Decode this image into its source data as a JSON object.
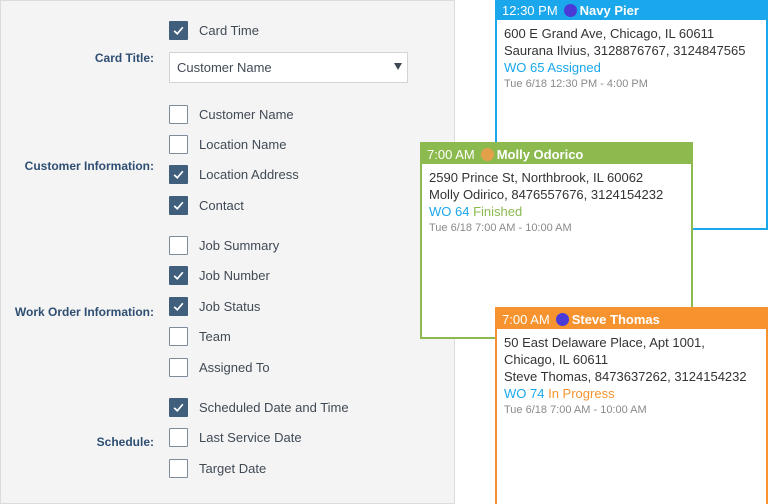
{
  "colors": {
    "blue_card": "#1aa7ec",
    "green_card": "#8cba4f",
    "orange_card": "#f7932e",
    "checkbox_checked": "#3f5f7d",
    "label_text": "#2e4e72",
    "wo_link": "#1aa7ec",
    "status_assigned": "#1aa7ec",
    "status_finished": "#8cba4f",
    "status_in_progress": "#f7932e"
  },
  "settings": {
    "card_time": {
      "label": "Card Time",
      "checked": true
    },
    "card_title": {
      "label": "Card Title:",
      "value": "Customer Name"
    },
    "customer_information": {
      "label": "Customer Information:",
      "options": [
        {
          "label": "Customer Name",
          "checked": false
        },
        {
          "label": "Location Name",
          "checked": false
        },
        {
          "label": "Location Address",
          "checked": true
        },
        {
          "label": "Contact",
          "checked": true
        }
      ]
    },
    "work_order_information": {
      "label": "Work Order Information:",
      "options": [
        {
          "label": "Job Summary",
          "checked": false
        },
        {
          "label": "Job Number",
          "checked": true
        },
        {
          "label": "Job Status",
          "checked": true
        },
        {
          "label": "Team",
          "checked": false
        },
        {
          "label": "Assigned To",
          "checked": false
        }
      ]
    },
    "schedule": {
      "label": "Schedule:",
      "options": [
        {
          "label": "Scheduled Date and Time",
          "checked": true
        },
        {
          "label": "Last Service Date",
          "checked": false
        },
        {
          "label": "Target Date",
          "checked": false
        }
      ]
    }
  },
  "cards": {
    "navy_pier": {
      "time": "12:30 PM",
      "name": "Navy Pier",
      "dot_color": "#4a3ad8",
      "address": "600 E Grand Ave, Chicago, IL 60611",
      "contact": "Saurana Ilvius, 3128876767, 3124847565",
      "wo": "WO 65",
      "status": "Assigned",
      "schedule": "Tue 6/18 12:30 PM - 4:00 PM"
    },
    "molly": {
      "time": "7:00 AM",
      "name": "Molly Odorico",
      "dot_color": "#e3a04a",
      "address": "2590 Prince St, Northbrook, IL 60062",
      "contact": "Molly Odirico, 8476557676, 3124154232",
      "wo": "WO 64",
      "status": "Finished",
      "schedule": "Tue 6/18 7:00 AM - 10:00 AM"
    },
    "steve": {
      "time": "7:00 AM",
      "name": "Steve Thomas",
      "dot_color": "#4a3ad8",
      "address_line1": "50 East Delaware Place, Apt 1001,",
      "address_line2": "Chicago, IL 60611",
      "contact": "Steve Thomas, 8473637262, 3124154232",
      "wo": "WO 74",
      "status": "In Progress",
      "schedule": "Tue 6/18 7:00 AM - 10:00 AM"
    }
  }
}
